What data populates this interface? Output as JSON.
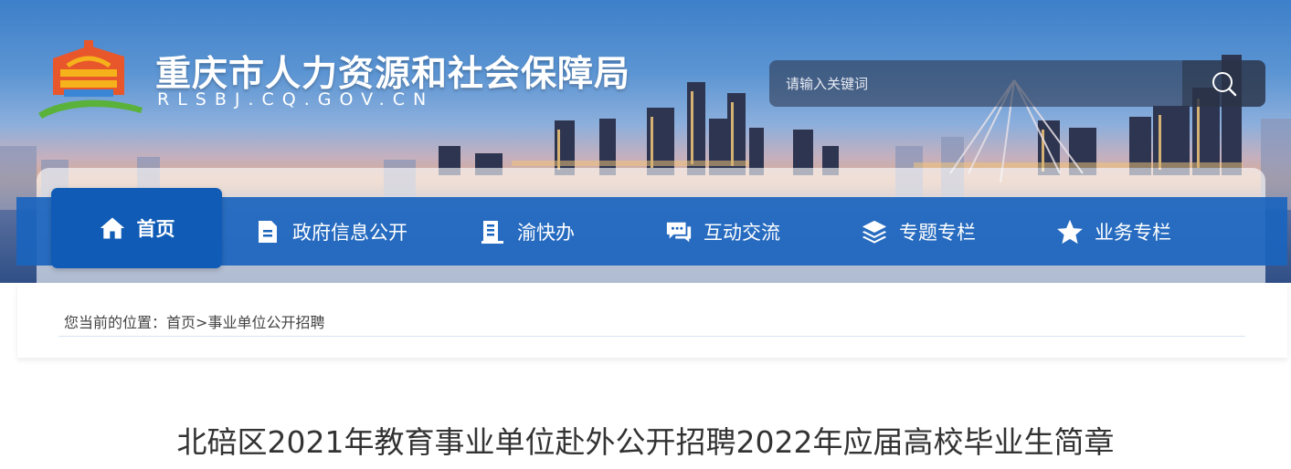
{
  "header": {
    "site_title": "重庆市人力资源和社会保障局",
    "site_domain": "RLSBJ.CQ.GOV.CN",
    "logo_icon": "bureau-logo-icon"
  },
  "search": {
    "placeholder": "请输入关键词",
    "icon": "search-icon"
  },
  "nav": {
    "items": [
      {
        "label": "首页",
        "icon": "home-icon",
        "active": true
      },
      {
        "label": "政府信息公开",
        "icon": "document-icon",
        "active": false
      },
      {
        "label": "渝快办",
        "icon": "clipboard-icon",
        "active": false
      },
      {
        "label": "互动交流",
        "icon": "chat-icon",
        "active": false
      },
      {
        "label": "专题专栏",
        "icon": "layers-icon",
        "active": false
      },
      {
        "label": "业务专栏",
        "icon": "star-icon",
        "active": false
      }
    ]
  },
  "breadcrumb": {
    "prefix": "您当前的位置：",
    "home": "首页",
    "separator": ">",
    "current": "事业单位公开招聘"
  },
  "article": {
    "title": "北碚区2021年教育事业单位赴外公开招聘2022年应届高校毕业生简章"
  },
  "colors": {
    "nav_bar": "#1a64be",
    "nav_active": "#0f5bb5",
    "title_text": "#333333"
  }
}
